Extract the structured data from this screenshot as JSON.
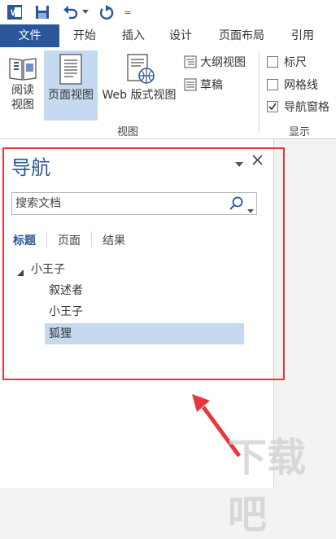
{
  "title_bar": {
    "app_icon_letter": "W",
    "qat_dropdown": "="
  },
  "tabs": [
    {
      "label": "文件",
      "active": true
    },
    {
      "label": "开始"
    },
    {
      "label": "插入"
    },
    {
      "label": "设计"
    },
    {
      "label": "页面布局"
    },
    {
      "label": "引用"
    }
  ],
  "ribbon": {
    "read_view_line1": "阅读",
    "read_view_line2": "视图",
    "print_layout": "页面视图",
    "web_layout": "Web 版式视图",
    "outline": "大纲视图",
    "draft": "草稿",
    "views_group_label": "视图",
    "ruler": "标尺",
    "gridlines": "网格线",
    "nav_pane": "导航窗格",
    "show_group_label": "显示",
    "ruler_checked": false,
    "gridlines_checked": false,
    "nav_pane_checked": true
  },
  "nav": {
    "title": "导航",
    "search_placeholder": "搜索文档",
    "tabs": [
      "标题",
      "页面",
      "结果"
    ],
    "active_tab": "标题",
    "tree": [
      {
        "label": "小王子",
        "level": 0,
        "expanded": true
      },
      {
        "label": "叙述者",
        "level": 1
      },
      {
        "label": "小王子",
        "level": 1
      },
      {
        "label": "狐狸",
        "level": 1,
        "selected": true
      }
    ]
  },
  "colors": {
    "accent": "#2b579a",
    "highlight": "#e8363e",
    "selection": "#c5d9f1"
  },
  "watermark": "下载吧"
}
